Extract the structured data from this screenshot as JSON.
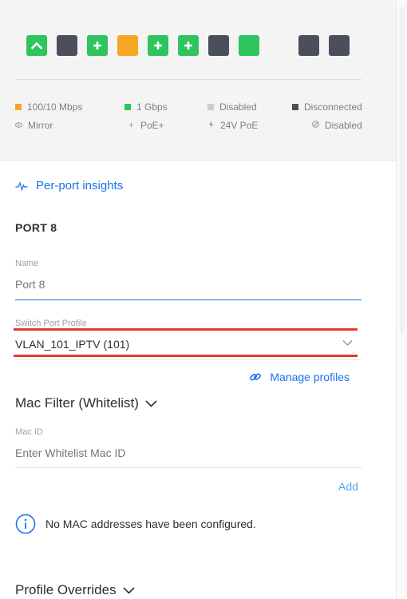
{
  "ports": [
    {
      "icon": "uplink",
      "color": "#2ec45e"
    },
    {
      "icon": "none",
      "color": "#4b4f5c"
    },
    {
      "icon": "plus",
      "color": "#2ec45e"
    },
    {
      "icon": "none",
      "color": "#f5a623"
    },
    {
      "icon": "plus",
      "color": "#2ec45e"
    },
    {
      "icon": "plus",
      "color": "#2ec45e"
    },
    {
      "icon": "none",
      "color": "#4b4f5c"
    },
    {
      "icon": "none",
      "color": "#2ec45e"
    },
    {
      "icon": "none",
      "color": "#4b4f5c"
    },
    {
      "icon": "none",
      "color": "#4b4f5c"
    }
  ],
  "legend": {
    "speed_100": {
      "label": "100/10 Mbps",
      "color": "#f5a623"
    },
    "speed_1g": {
      "label": "1 Gbps",
      "color": "#2ec45e"
    },
    "disabled": {
      "label": "Disabled",
      "color": "#cdcdcd"
    },
    "disconnected": {
      "label": "Disconnected",
      "color": "#4b4f5c"
    },
    "mirror": {
      "label": "Mirror",
      "icon": "eye-icon"
    },
    "poe_plus": {
      "label": "PoE+",
      "icon": "plus-icon"
    },
    "poe_24v": {
      "label": "24V PoE",
      "icon": "bolt-icon"
    },
    "poe_disabled": {
      "label": "Disabled",
      "icon": "disabled-icon"
    }
  },
  "insights_label": "Per-port insights",
  "port_title": "PORT 8",
  "name_field": {
    "label": "Name",
    "placeholder": "Port 8",
    "value": ""
  },
  "profile_field": {
    "label": "Switch Port Profile",
    "value": "VLAN_101_IPTV (101)"
  },
  "manage_profiles": "Manage profiles",
  "mac_filter": {
    "heading": "Mac Filter (Whitelist)",
    "label": "Mac ID",
    "placeholder": "Enter Whitelist Mac ID",
    "add_label": "Add",
    "empty_message": "No MAC addresses have been configured."
  },
  "profile_overrides": "Profile Overrides",
  "colors": {
    "accent": "#1a73e8",
    "highlight": "#e53935"
  }
}
